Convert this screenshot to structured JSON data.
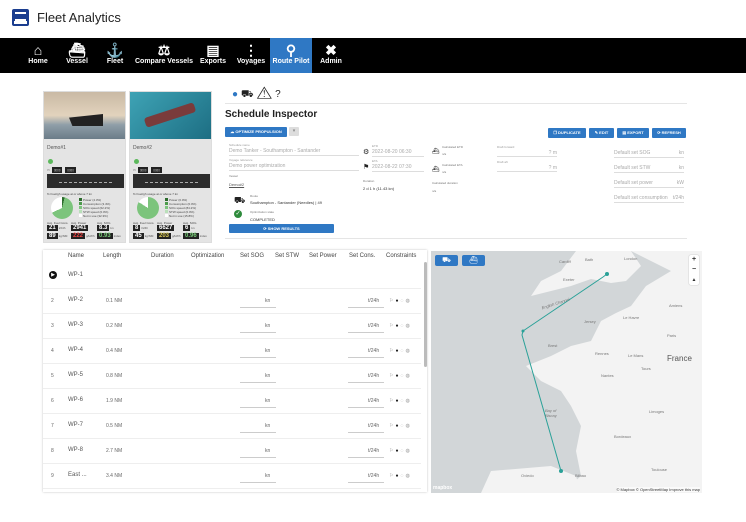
{
  "header": {
    "app_title": "Fleet Analytics",
    "logo": "yara-logo"
  },
  "nav": {
    "items": [
      {
        "label": "Home",
        "icon": "home-icon",
        "glyph": "⌂"
      },
      {
        "label": "Vessel",
        "icon": "ship-icon",
        "glyph": "⛴"
      },
      {
        "label": "Fleet",
        "icon": "anchor-icon",
        "glyph": "⚓"
      },
      {
        "label": "Compare Vessels",
        "icon": "scale-icon",
        "glyph": "⚖"
      },
      {
        "label": "Exports",
        "icon": "file-chart-icon",
        "glyph": "▤"
      },
      {
        "label": "Voyages",
        "icon": "route-line-icon",
        "glyph": "⋮"
      },
      {
        "label": "Route Pilot",
        "icon": "route-icon",
        "glyph": "⚲",
        "active": true
      },
      {
        "label": "Admin",
        "icon": "tools-icon",
        "glyph": "✖"
      }
    ]
  },
  "vessels": [
    {
      "name": "Demo#1",
      "usage_title": "% Fuel/gh usage at or above 7 kn",
      "legend": [
        "Power (4.3%)",
        "Consumption (3.4%)",
        "SOG speed (62.2%)",
        "STW speed (0.0%)",
        "Not in use (32.3%)"
      ],
      "kpis": [
        {
          "label": "Avg. Fuel Cons.",
          "value": "21",
          "unit": "t/24h"
        },
        {
          "label": "Avg. Power",
          "value": "2941",
          "unit": "kW"
        },
        {
          "label": "Avg. SOG",
          "value": "8.3",
          "unit": "kn"
        },
        {
          "label": "Avg. Fuel Cons. by Distance",
          "value": "89",
          "unit": "kg/NM"
        },
        {
          "label": "Avg. SFOC",
          "value": "222",
          "unit": "g/kWh",
          "tone": "red"
        },
        {
          "label": "Hull & Propeller Performance",
          "value": "0.93",
          "unit": "index",
          "tone": "grn"
        }
      ]
    },
    {
      "name": "Demo#2",
      "usage_title": "% Fuel/gh usage at or above 7 kn",
      "legend": [
        "Power (0.0%)",
        "Consumption (0.0%)",
        "SOG speed (84.2%)",
        "STW speed (0.0%)",
        "Not in use (15.8%)"
      ],
      "kpis": [
        {
          "label": "Avg. Fuel Cons.",
          "value": "8",
          "unit": "t/24h"
        },
        {
          "label": "Avg. Power",
          "value": "6627",
          "unit": "kW"
        },
        {
          "label": "Avg. SOG",
          "value": "6",
          "unit": "kn"
        },
        {
          "label": "Avg. Fuel Cons. by Distance",
          "value": "45",
          "unit": "kg/NM"
        },
        {
          "label": "Avg. SFOC",
          "value": "203",
          "unit": "g/kWh",
          "tone": "yel"
        },
        {
          "label": "Hull & Propeller Performance",
          "value": "0.96",
          "unit": "index",
          "tone": "grn"
        }
      ]
    }
  ],
  "toolbar": {
    "help": "?"
  },
  "inspector": {
    "title": "Schedule Inspector",
    "optimize_label": "OPTIMIZE PROPULSION",
    "duplicate_label": "DUPLICATE",
    "edit_label": "EDIT",
    "export_label": "EXPORT",
    "refresh_label": "REFRESH",
    "schedule_name_label": "Schedule name",
    "schedule_name": "Demo Tanker - Southampton - Santander",
    "voyage_ref_label": "Voyage reference",
    "voyage_ref": "Demo power optimization",
    "vessel_label": "Vessel",
    "vessel": "Demo#2",
    "route_label": "Route",
    "route": "Southampton - Santander (Needles) | 49",
    "opt_state_label": "Optimization state",
    "opt_state": "COMPLETED",
    "show_results_label": "SHOW RESULTS",
    "etd_label": "ETD",
    "etd": "2022-08-20 06:30",
    "eta_label": "ETA",
    "eta": "2022-08-22 07:30",
    "duration_label": "Duration",
    "duration": "2 d 1 h (11.43 kn)",
    "calc_etd_label": "Calculated ETD",
    "calc_etd": "n/a",
    "calc_eta_label": "Calculated ETA",
    "calc_eta": "n/a",
    "calc_dur_label": "Calculated duration",
    "calc_dur": "n/a",
    "draft_fwd_label": "Draft forward",
    "draft_fwd_unit": "m",
    "draft_aft_label": "Draft aft",
    "draft_aft_unit": "m",
    "defaults": [
      {
        "label": "Default set SOG",
        "unit": "kn"
      },
      {
        "label": "Default set STW",
        "unit": "kn"
      },
      {
        "label": "Default set power",
        "unit": "kW"
      },
      {
        "label": "Default set consumption",
        "unit": "t/24h"
      }
    ]
  },
  "table": {
    "headers": [
      "Name",
      "Length",
      "Duration",
      "Optimization",
      "Set SOG",
      "Set STW",
      "Set Power",
      "Set Cons.",
      "Constraints"
    ],
    "rows": [
      {
        "idx": "",
        "name": "WP-1",
        "length": "",
        "start": true
      },
      {
        "idx": "2",
        "name": "WP-2",
        "length": "0.1 NM"
      },
      {
        "idx": "3",
        "name": "WP-3",
        "length": "0.2 NM"
      },
      {
        "idx": "4",
        "name": "WP-4",
        "length": "0.4 NM"
      },
      {
        "idx": "5",
        "name": "WP-5",
        "length": "0.8 NM"
      },
      {
        "idx": "6",
        "name": "WP-6",
        "length": "1.9 NM"
      },
      {
        "idx": "7",
        "name": "WP-7",
        "length": "0.5 NM"
      },
      {
        "idx": "8",
        "name": "WP-8",
        "length": "2.7 NM"
      },
      {
        "idx": "9",
        "name": "East ...",
        "length": "3.4 NM"
      }
    ],
    "sog_unit": "kn",
    "cons_unit": "t/24h"
  },
  "map": {
    "zoom_in": "+",
    "zoom_out": "−",
    "compass": "▲",
    "labels": [
      "Cardiff",
      "Bath",
      "London",
      "Exeter",
      "English Channel",
      "Jersey",
      "Le Havre",
      "Amiens",
      "Paris",
      "Brest",
      "Rennes",
      "Le Mans",
      "France",
      "Tours",
      "Nantes",
      "Bay of Biscay",
      "Limoges",
      "Bordeaux",
      "Toulouse",
      "Oviedo",
      "Bilbao"
    ],
    "attribution": "© Mapbox © OpenStreetMap Improve this map",
    "brand": "mapbox",
    "route_color": "#2aa198"
  }
}
